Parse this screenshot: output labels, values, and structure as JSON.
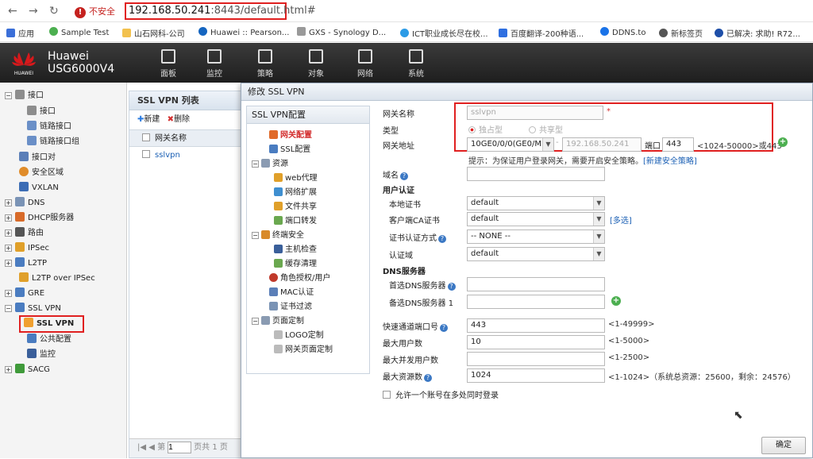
{
  "browser": {
    "security_label": "不安全",
    "url_host": "192.168.50.241",
    "url_rest": ":8443/default.html#",
    "bookmarks": [
      "应用",
      "Sample Test",
      "山石网科-公司",
      "Huawei :: Pearson...",
      "GXS - Synology D...",
      "ICT职业成长尽在校...",
      "百度翻译-200种语...",
      "DDNS.to",
      "新标签页",
      "已解决: 求助! R72..."
    ]
  },
  "app": {
    "vendor": "Huawei",
    "model": "USG6000V4",
    "logo_text": "HUAWEI",
    "nav": [
      "面板",
      "监控",
      "策略",
      "对象",
      "网络",
      "系统"
    ]
  },
  "left_tree": [
    {
      "label": "接口",
      "expander": "−"
    },
    {
      "label": "接口",
      "expander": ""
    },
    {
      "label": "链路接口",
      "expander": ""
    },
    {
      "label": "链路接口组",
      "expander": ""
    },
    {
      "label": "接口对",
      "expander": ""
    },
    {
      "label": "安全区域",
      "expander": ""
    },
    {
      "label": "VXLAN",
      "expander": ""
    },
    {
      "label": "DNS",
      "expander": "+"
    },
    {
      "label": "DHCP服务器",
      "expander": "+"
    },
    {
      "label": "路由",
      "expander": "+"
    },
    {
      "label": "IPSec",
      "expander": "+"
    },
    {
      "label": "L2TP",
      "expander": "+"
    },
    {
      "label": "L2TP over IPSec",
      "expander": ""
    },
    {
      "label": "GRE",
      "expander": "+"
    },
    {
      "label": "SSL VPN",
      "expander": "−"
    },
    {
      "label": "SSL VPN",
      "expander": ""
    },
    {
      "label": "公共配置",
      "expander": ""
    },
    {
      "label": "监控",
      "expander": ""
    },
    {
      "label": "SACG",
      "expander": "+"
    }
  ],
  "list": {
    "title": "SSL VPN 列表",
    "new_label": "新建",
    "delete_label": "删除",
    "col_name": "网关名称",
    "rows": [
      "sslvpn"
    ],
    "page_label": "第",
    "page_value": "1",
    "total_label": "页共 1 页"
  },
  "dialog": {
    "title": "修改 SSL VPN",
    "tree_title": "SSL VPN配置",
    "tree": [
      "网关配置",
      "SSL配置",
      "资源",
      "web代理",
      "网络扩展",
      "文件共享",
      "端口转发",
      "终端安全",
      "主机检查",
      "缓存清理",
      "角色授权/用户",
      "MAC认证",
      "证书过滤",
      "页面定制",
      "LOGO定制",
      "网关页面定制"
    ],
    "fields": {
      "gateway_name_label": "网关名称",
      "gateway_name_value": "sslvpn",
      "required_mark": "*",
      "type_label": "类型",
      "type_exclusive": "独占型",
      "type_shared": "共享型",
      "gateway_addr_label": "网关地址",
      "iface_value": "10GE0/0/0(GE0/M",
      "ip_value": "192.168.50.241",
      "port_label": "端口",
      "port_value": "443",
      "port_range": "<1024-50000>或443",
      "tip": "提示：为保证用户登录网关，需要开启安全策略。",
      "tip_link": "[新建安全策略]",
      "domain_label": "域名",
      "user_auth_header": "用户认证",
      "local_cert_label": "本地证书",
      "local_cert_value": "default",
      "client_ca_label": "客户端CA证书",
      "client_ca_value": "default",
      "multi_select_link": "[多选]",
      "cert_auth_label": "证书认证方式",
      "cert_auth_value": "-- NONE --",
      "auth_domain_label": "认证域",
      "auth_domain_value": "default",
      "dns_header": "DNS服务器",
      "dns1_label": "首选DNS服务器",
      "dns2_label": "备选DNS服务器 1",
      "fast_port_label": "快速通道端口号",
      "fast_port_value": "443",
      "fast_port_range": "<1-49999>",
      "max_users_label": "最大用户数",
      "max_users_value": "10",
      "max_users_range": "<1-5000>",
      "max_conc_label": "最大并发用户数",
      "max_conc_value": "",
      "max_conc_range": "<1-2500>",
      "max_res_label": "最大资源数",
      "max_res_value": "1024",
      "max_res_range": "<1-1024>（系统总资源：25600，剩余：24576）",
      "multi_login_label": "允许一个账号在多处同时登录"
    },
    "ok_label": "确定"
  },
  "colors": {
    "highlight": "#e02020",
    "link": "#1a5fb4",
    "accent": "#4caf50"
  }
}
